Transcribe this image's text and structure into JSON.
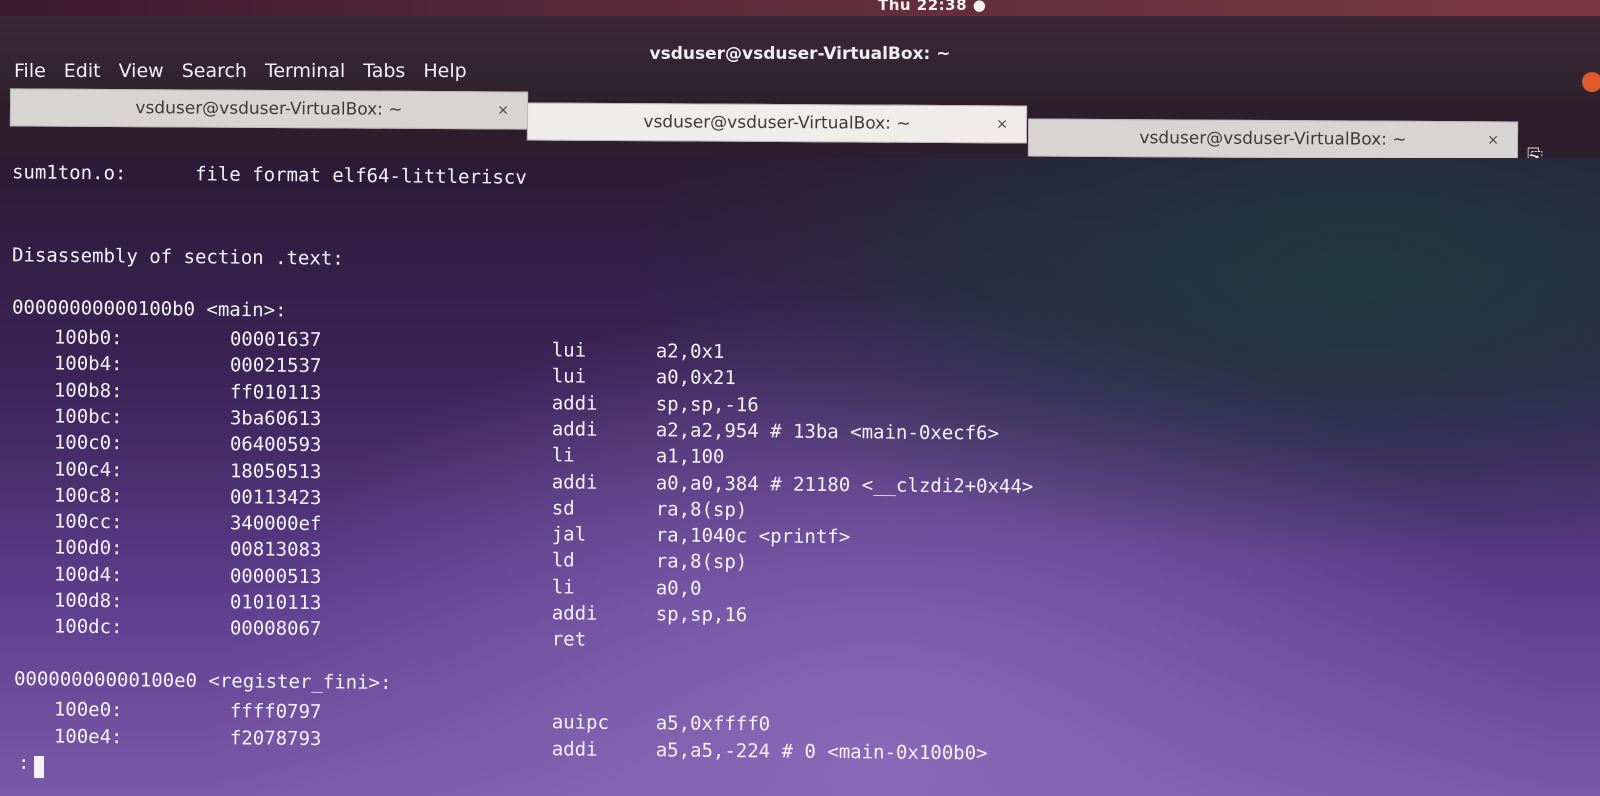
{
  "system": {
    "clock": "Thu 22:38 ●"
  },
  "window": {
    "title": "vsduser@vsduser-VirtualBox: ~",
    "menu": [
      "File",
      "Edit",
      "View",
      "Search",
      "Terminal",
      "Tabs",
      "Help"
    ],
    "tabs": [
      {
        "label": "vsduser@vsduser-VirtualBox: ~",
        "close": "×"
      },
      {
        "label": "vsduser@vsduser-VirtualBox: ~",
        "close": "×"
      },
      {
        "label": "vsduser@vsduser-VirtualBox: ~",
        "close": "×"
      }
    ],
    "active_tab": 1,
    "new_tab_icon": "⎘"
  },
  "terminal": {
    "header": "sum1ton.o:      file format elf64-littleriscv",
    "section": "Disassembly of section .text:",
    "main_label": "00000000000100b0 <main>:",
    "main_rows": [
      {
        "addr": "100b0:",
        "code": "00001637",
        "op": "lui",
        "args": "a2,0x1"
      },
      {
        "addr": "100b4:",
        "code": "00021537",
        "op": "lui",
        "args": "a0,0x21"
      },
      {
        "addr": "100b8:",
        "code": "ff010113",
        "op": "addi",
        "args": "sp,sp,-16"
      },
      {
        "addr": "100bc:",
        "code": "3ba60613",
        "op": "addi",
        "args": "a2,a2,954 # 13ba <main-0xecf6>"
      },
      {
        "addr": "100c0:",
        "code": "06400593",
        "op": "li",
        "args": "a1,100"
      },
      {
        "addr": "100c4:",
        "code": "18050513",
        "op": "addi",
        "args": "a0,a0,384 # 21180 <__clzdi2+0x44>"
      },
      {
        "addr": "100c8:",
        "code": "00113423",
        "op": "sd",
        "args": "ra,8(sp)"
      },
      {
        "addr": "100cc:",
        "code": "340000ef",
        "op": "jal",
        "args": "ra,1040c <printf>"
      },
      {
        "addr": "100d0:",
        "code": "00813083",
        "op": "ld",
        "args": "ra,8(sp)"
      },
      {
        "addr": "100d4:",
        "code": "00000513",
        "op": "li",
        "args": "a0,0"
      },
      {
        "addr": "100d8:",
        "code": "01010113",
        "op": "addi",
        "args": "sp,sp,16"
      },
      {
        "addr": "100dc:",
        "code": "00008067",
        "op": "ret",
        "args": ""
      }
    ],
    "fini_label": "00000000000100e0 <register_fini>:",
    "fini_rows": [
      {
        "addr": "100e0:",
        "code": "ffff0797",
        "op": "auipc",
        "args": "a5,0xffff0"
      },
      {
        "addr": "100e4:",
        "code": "f2078793",
        "op": "addi",
        "args": "a5,a5,-224 # 0 <main-0x100b0>"
      }
    ],
    "prompt": ":"
  }
}
